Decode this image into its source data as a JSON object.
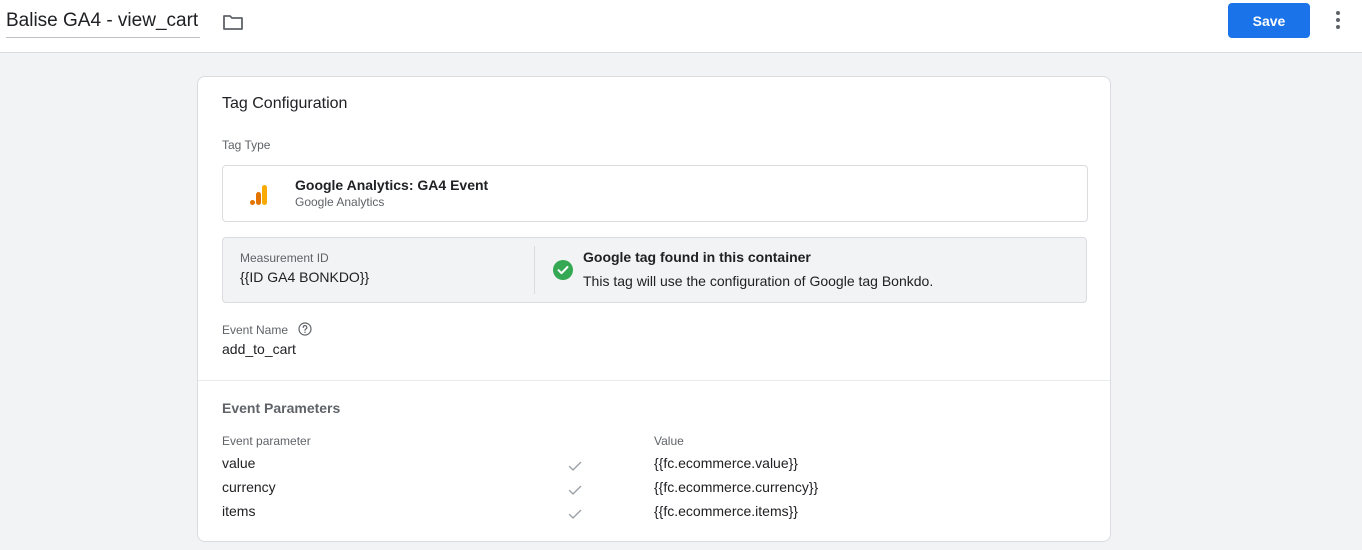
{
  "header": {
    "title": "Balise GA4 - view_cart",
    "save_label": "Save"
  },
  "tag_config": {
    "title": "Tag Configuration",
    "tag_type_label": "Tag Type",
    "tag_type_name": "Google Analytics: GA4 Event",
    "tag_type_vendor": "Google Analytics",
    "measurement_id_label": "Measurement ID",
    "measurement_id_value": "{{ID GA4 BONKDO}}",
    "google_tag_status_title": "Google tag found in this container",
    "google_tag_status_desc": "This tag will use the configuration of Google tag Bonkdo.",
    "event_name_label": "Event Name",
    "event_name_value": "add_to_cart",
    "event_params_title": "Event Parameters",
    "event_params_col_param": "Event parameter",
    "event_params_col_value": "Value",
    "event_params": [
      {
        "name": "value",
        "value": "{{fc.ecommerce.value}}"
      },
      {
        "name": "currency",
        "value": "{{fc.ecommerce.currency}}"
      },
      {
        "name": "items",
        "value": "{{fc.ecommerce.items}}"
      }
    ]
  },
  "icons": {
    "folder": "folder-icon",
    "more": "more-vert-icon",
    "analytics": "google-analytics-icon",
    "check": "check-circle-icon",
    "help": "help-icon",
    "param_check": "check-icon"
  },
  "colors": {
    "accent": "#1a73e8",
    "success": "#34a853",
    "analytics_orange": "#f9ab00",
    "analytics_dark": "#e37400"
  }
}
